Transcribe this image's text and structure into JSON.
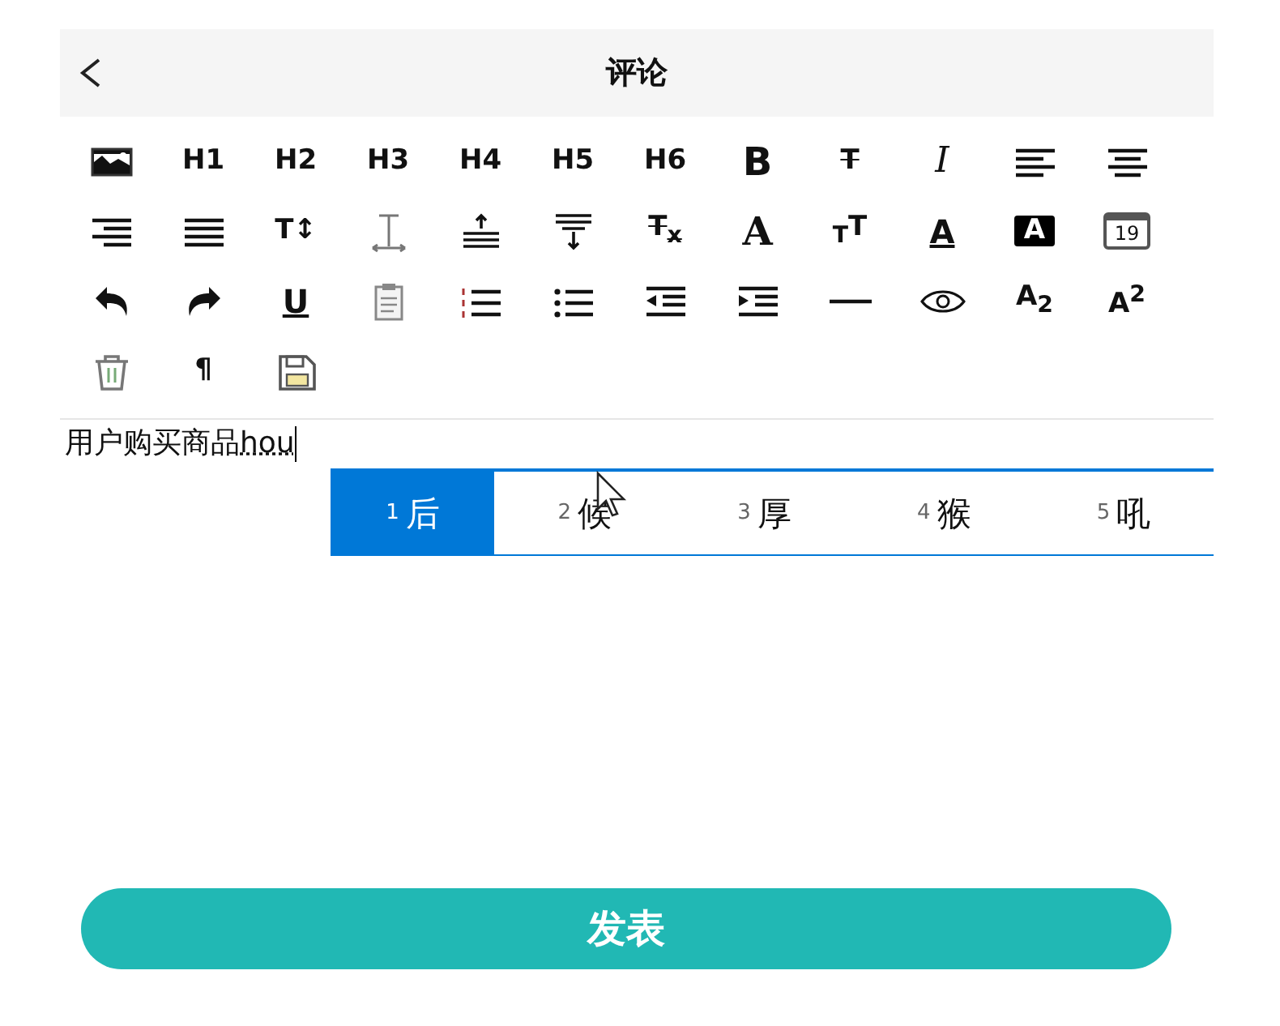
{
  "header": {
    "title": "评论"
  },
  "toolbar": [
    {
      "kind": "icon"
    },
    {
      "kind": "label",
      "text": "H1"
    },
    {
      "kind": "label",
      "text": "H2"
    },
    {
      "kind": "label",
      "text": "H3"
    },
    {
      "kind": "label",
      "text": "H4"
    },
    {
      "kind": "label",
      "text": "H5"
    },
    {
      "kind": "label",
      "text": "H6"
    },
    {
      "kind": "bold",
      "text": "B"
    },
    {
      "kind": "struck",
      "text": "T"
    },
    {
      "kind": "italic",
      "text": "I"
    },
    {
      "kind": "icon"
    },
    {
      "kind": "icon"
    },
    {
      "kind": "icon"
    },
    {
      "kind": "icon"
    },
    {
      "kind": "label",
      "text": "T↕"
    },
    {
      "kind": "icon"
    },
    {
      "kind": "icon"
    },
    {
      "kind": "icon"
    },
    {
      "kind": "struck",
      "text": "T$_{x}$"
    },
    {
      "kind": "big",
      "text": "A"
    },
    {
      "kind": "label",
      "text": "$_{T}$T"
    },
    {
      "kind": "underlined",
      "text": "A"
    },
    {
      "kind": "boxed",
      "text": "A"
    },
    {
      "kind": "calendar",
      "text": "19"
    },
    {
      "kind": "icon"
    },
    {
      "kind": "icon"
    },
    {
      "kind": "underlined",
      "text": "U"
    },
    {
      "kind": "icon"
    },
    {
      "kind": "icon"
    },
    {
      "kind": "icon"
    },
    {
      "kind": "icon"
    },
    {
      "kind": "icon"
    },
    {
      "kind": "icon"
    },
    {
      "kind": "icon"
    },
    {
      "kind": "label",
      "text": "A$_{2}$"
    },
    {
      "kind": "label",
      "text": "A$^{2}$"
    },
    {
      "kind": "icon"
    },
    {
      "kind": "label",
      "text": "¶"
    },
    {
      "kind": "icon"
    }
  ],
  "editor": {
    "value": "用户购买商品",
    "composition": "hou"
  },
  "ime": {
    "candidates": [
      {
        "number": "1",
        "text": "后",
        "selected": true
      },
      {
        "number": "2",
        "text": "候",
        "selected": false
      },
      {
        "number": "3",
        "text": "厚",
        "selected": false
      },
      {
        "number": "4",
        "text": "猴",
        "selected": false
      },
      {
        "number": "5",
        "text": "吼",
        "selected": false
      }
    ]
  },
  "submit_button": {
    "label": "发表"
  }
}
